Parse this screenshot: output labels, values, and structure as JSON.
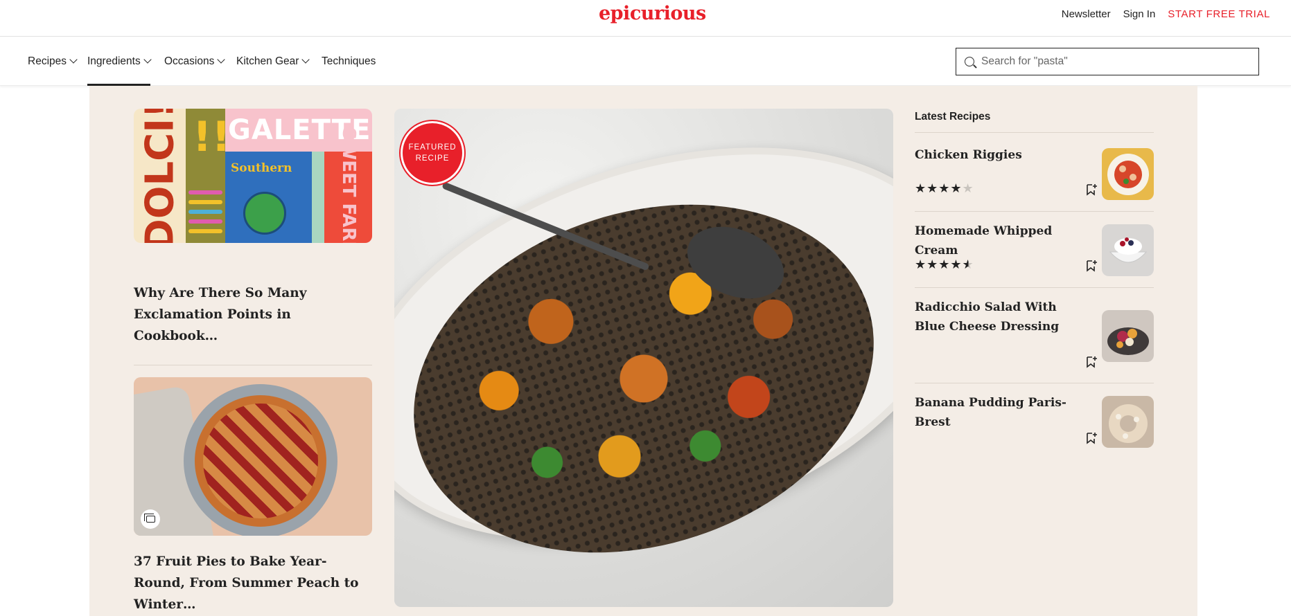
{
  "header": {
    "logo": "epicurious",
    "links": {
      "newsletter": "Newsletter",
      "sign_in": "Sign In",
      "trial": "START FREE TRIAL"
    }
  },
  "nav": {
    "items": [
      {
        "label": "Recipes",
        "has_dropdown": true,
        "active": false
      },
      {
        "label": "Ingredients",
        "has_dropdown": true,
        "active": true
      },
      {
        "label": "Occasions",
        "has_dropdown": true,
        "active": false
      },
      {
        "label": "Kitchen Gear",
        "has_dropdown": true,
        "active": false
      },
      {
        "label": "Techniques",
        "has_dropdown": false,
        "active": false
      }
    ],
    "search_placeholder": "Search for \"pasta\""
  },
  "left_column": {
    "cookbooks": {
      "cover_texts": [
        "DOLCI!",
        "GALETTE!",
        "Southern",
        "SWEET FARM!"
      ]
    },
    "article1_title": "Why Are There So Many Exclamation Points in Cookbook…",
    "article2_title": "37 Fruit Pies to Bake Year-Round, From Summer Peach to Winter…"
  },
  "featured": {
    "badge_line1": "FEATURED",
    "badge_line2": "RECIPE"
  },
  "latest": {
    "title": "Latest Recipes",
    "recipes": [
      {
        "name": "Chicken Riggies",
        "rating": 4,
        "thumb_color": "#e4a437"
      },
      {
        "name": "Homemade Whipped Cream",
        "rating": 4.5,
        "thumb_color": "#c9c6c4"
      },
      {
        "name": "Radicchio Salad With Blue Cheese Dressing",
        "rating": 0,
        "thumb_color": "#a8503e"
      },
      {
        "name": "Banana Pudding Paris-Brest",
        "rating": 0,
        "thumb_color": "#d9c3ad"
      }
    ]
  },
  "colors": {
    "brand_red": "#e8202a",
    "panel_beige": "#f4ede6",
    "text": "#222222"
  }
}
